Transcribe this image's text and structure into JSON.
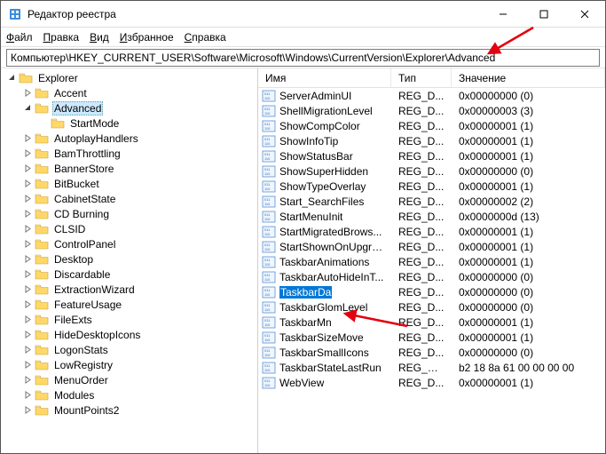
{
  "window": {
    "title": "Редактор реестра"
  },
  "menu": {
    "file": "Файл",
    "edit": "Правка",
    "view": "Вид",
    "favorites": "Избранное",
    "help": "Справка"
  },
  "address": "Компьютер\\HKEY_CURRENT_USER\\Software\\Microsoft\\Windows\\CurrentVersion\\Explorer\\Advanced",
  "tree": [
    {
      "indent": 0,
      "label": "Explorer",
      "expanded": true,
      "selected": false
    },
    {
      "indent": 1,
      "label": "Accent",
      "expanded": false,
      "selected": false
    },
    {
      "indent": 1,
      "label": "Advanced",
      "expanded": true,
      "selected": true
    },
    {
      "indent": 2,
      "label": "StartMode",
      "expanded": false,
      "selected": false,
      "leaf": true
    },
    {
      "indent": 1,
      "label": "AutoplayHandlers",
      "expanded": false,
      "selected": false
    },
    {
      "indent": 1,
      "label": "BamThrottling",
      "expanded": false,
      "selected": false
    },
    {
      "indent": 1,
      "label": "BannerStore",
      "expanded": false,
      "selected": false
    },
    {
      "indent": 1,
      "label": "BitBucket",
      "expanded": false,
      "selected": false
    },
    {
      "indent": 1,
      "label": "CabinetState",
      "expanded": false,
      "selected": false
    },
    {
      "indent": 1,
      "label": "CD Burning",
      "expanded": false,
      "selected": false
    },
    {
      "indent": 1,
      "label": "CLSID",
      "expanded": false,
      "selected": false
    },
    {
      "indent": 1,
      "label": "ControlPanel",
      "expanded": false,
      "selected": false
    },
    {
      "indent": 1,
      "label": "Desktop",
      "expanded": false,
      "selected": false
    },
    {
      "indent": 1,
      "label": "Discardable",
      "expanded": false,
      "selected": false
    },
    {
      "indent": 1,
      "label": "ExtractionWizard",
      "expanded": false,
      "selected": false
    },
    {
      "indent": 1,
      "label": "FeatureUsage",
      "expanded": false,
      "selected": false
    },
    {
      "indent": 1,
      "label": "FileExts",
      "expanded": false,
      "selected": false
    },
    {
      "indent": 1,
      "label": "HideDesktopIcons",
      "expanded": false,
      "selected": false
    },
    {
      "indent": 1,
      "label": "LogonStats",
      "expanded": false,
      "selected": false
    },
    {
      "indent": 1,
      "label": "LowRegistry",
      "expanded": false,
      "selected": false
    },
    {
      "indent": 1,
      "label": "MenuOrder",
      "expanded": false,
      "selected": false
    },
    {
      "indent": 1,
      "label": "Modules",
      "expanded": false,
      "selected": false
    },
    {
      "indent": 1,
      "label": "MountPoints2",
      "expanded": false,
      "selected": false
    }
  ],
  "columns": {
    "name": "Имя",
    "type": "Тип",
    "value": "Значение"
  },
  "values": [
    {
      "name": "ServerAdminUI",
      "type": "REG_D...",
      "data": "0x00000000 (0)",
      "selected": false
    },
    {
      "name": "ShellMigrationLevel",
      "type": "REG_D...",
      "data": "0x00000003 (3)",
      "selected": false
    },
    {
      "name": "ShowCompColor",
      "type": "REG_D...",
      "data": "0x00000001 (1)",
      "selected": false
    },
    {
      "name": "ShowInfoTip",
      "type": "REG_D...",
      "data": "0x00000001 (1)",
      "selected": false
    },
    {
      "name": "ShowStatusBar",
      "type": "REG_D...",
      "data": "0x00000001 (1)",
      "selected": false
    },
    {
      "name": "ShowSuperHidden",
      "type": "REG_D...",
      "data": "0x00000000 (0)",
      "selected": false
    },
    {
      "name": "ShowTypeOverlay",
      "type": "REG_D...",
      "data": "0x00000001 (1)",
      "selected": false
    },
    {
      "name": "Start_SearchFiles",
      "type": "REG_D...",
      "data": "0x00000002 (2)",
      "selected": false
    },
    {
      "name": "StartMenuInit",
      "type": "REG_D...",
      "data": "0x0000000d (13)",
      "selected": false
    },
    {
      "name": "StartMigratedBrows...",
      "type": "REG_D...",
      "data": "0x00000001 (1)",
      "selected": false
    },
    {
      "name": "StartShownOnUpgra...",
      "type": "REG_D...",
      "data": "0x00000001 (1)",
      "selected": false
    },
    {
      "name": "TaskbarAnimations",
      "type": "REG_D...",
      "data": "0x00000001 (1)",
      "selected": false
    },
    {
      "name": "TaskbarAutoHideInT...",
      "type": "REG_D...",
      "data": "0x00000000 (0)",
      "selected": false
    },
    {
      "name": "TaskbarDa",
      "type": "REG_D...",
      "data": "0x00000000 (0)",
      "selected": true
    },
    {
      "name": "TaskbarGlomLevel",
      "type": "REG_D...",
      "data": "0x00000000 (0)",
      "selected": false
    },
    {
      "name": "TaskbarMn",
      "type": "REG_D...",
      "data": "0x00000001 (1)",
      "selected": false
    },
    {
      "name": "TaskbarSizeMove",
      "type": "REG_D...",
      "data": "0x00000001 (1)",
      "selected": false
    },
    {
      "name": "TaskbarSmallIcons",
      "type": "REG_D...",
      "data": "0x00000000 (0)",
      "selected": false
    },
    {
      "name": "TaskbarStateLastRun",
      "type": "REG_BI...",
      "data": "b2 18 8a 61 00 00 00 00",
      "selected": false
    },
    {
      "name": "WebView",
      "type": "REG_D...",
      "data": "0x00000001 (1)",
      "selected": false
    }
  ]
}
